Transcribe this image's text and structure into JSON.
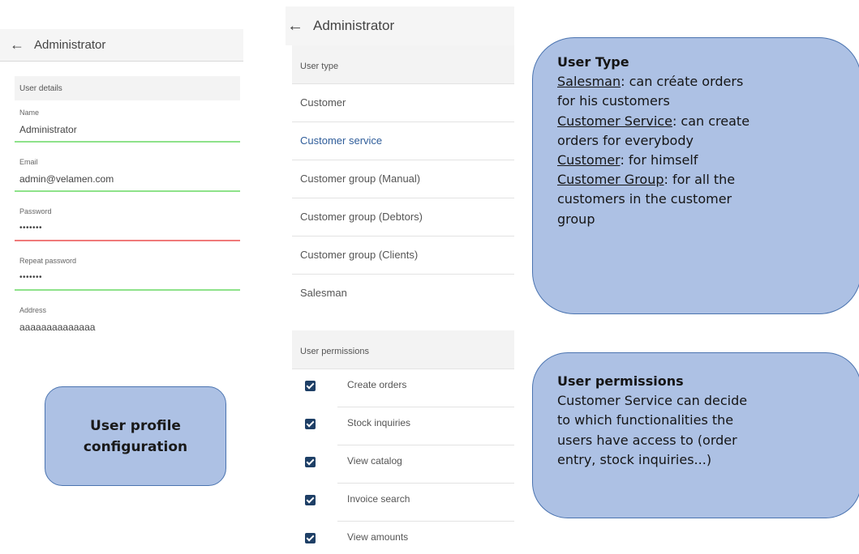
{
  "profile_screen": {
    "title": "Administrator",
    "section": "User details",
    "fields": [
      {
        "label": "Name",
        "value": "Administrator"
      },
      {
        "label": "Email",
        "value": "admin@velamen.com"
      },
      {
        "label": "Password",
        "value": "•••••••"
      },
      {
        "label": "Repeat password",
        "value": "•••••••"
      },
      {
        "label": "Address",
        "value": "aaaaaaaaaaaaaa"
      }
    ]
  },
  "type_screen": {
    "title": "Administrator",
    "user_type_header": "User type",
    "types": [
      {
        "label": "Customer",
        "selected": false
      },
      {
        "label": "Customer service",
        "selected": true
      },
      {
        "label": "Customer group (Manual)",
        "selected": false
      },
      {
        "label": "Customer group (Debtors)",
        "selected": false
      },
      {
        "label": "Customer group (Clients)",
        "selected": false
      },
      {
        "label": "Salesman",
        "selected": false
      }
    ],
    "permissions_header": "User permissions",
    "permissions": [
      {
        "label": "Create orders",
        "checked": true
      },
      {
        "label": "Stock inquiries",
        "checked": true
      },
      {
        "label": "View catalog",
        "checked": true
      },
      {
        "label": "Invoice search",
        "checked": true
      },
      {
        "label": "View amounts",
        "checked": true
      }
    ]
  },
  "callouts": {
    "profile": {
      "line1": "User profile",
      "line2": "configuration"
    },
    "user_type": {
      "heading": "User Type",
      "salesman_term": "Salesman",
      "salesman_desc_1": ": can créate orders",
      "salesman_desc_2": "for his customers",
      "service_term": "Customer Service",
      "service_desc_1": ": can create",
      "service_desc_2": "orders for everybody",
      "customer_term": "Customer",
      "customer_desc": ": for himself",
      "group_term": "Customer Group",
      "group_desc_1": ": for all the",
      "group_desc_2": "customers in the customer",
      "group_desc_3": "group"
    },
    "permissions": {
      "heading": "User permissions",
      "line1": "Customer Service can decide",
      "line2": "to which functionalities the",
      "line3": "users have access to (order",
      "line4": "entry, stock inquiries...)"
    }
  },
  "colors": {
    "valid_line": "#8ee28a",
    "error_line": "#f07a7a",
    "selected_text": "#2f5d9a",
    "checkbox": "#1e3f66",
    "callout_fill": "#adc1e4",
    "callout_border": "#4b74b0"
  },
  "icons": {
    "back": "arrow-left-icon",
    "check": "checkbox-checked-icon"
  }
}
